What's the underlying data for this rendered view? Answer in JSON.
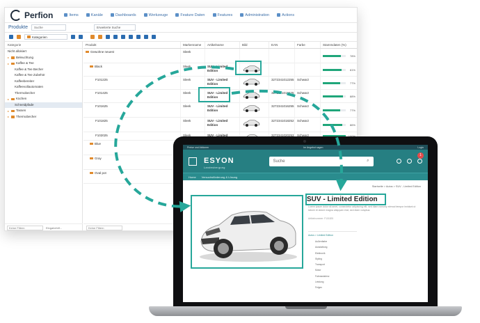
{
  "app": {
    "brand": "Perfion",
    "menu": [
      "Items",
      "Kanäle",
      "Dashboards",
      "Werkzeuge",
      "Feature Daten",
      "Features",
      "Administration",
      "Actions"
    ],
    "tab_title": "Produkte",
    "search_placeholder": "Suche",
    "extended_search": "Erweiterte Suche",
    "category_select": "Kategorien"
  },
  "tree": {
    "header": "Kategorie",
    "items": [
      {
        "label": "Nicht allokiert",
        "level": 0,
        "folder": false
      },
      {
        "label": "Beleuchtung",
        "level": 0,
        "folder": true
      },
      {
        "label": "Kaffee & Tee",
        "level": 0,
        "folder": true
      },
      {
        "label": "Kaffee & Tee Becher",
        "level": 1,
        "folder": false
      },
      {
        "label": "Kaffee & Tee Zubehör",
        "level": 1,
        "folder": false
      },
      {
        "label": "Kaffeebereiter",
        "level": 1,
        "folder": false
      },
      {
        "label": "Kaffeevollautomaten",
        "level": 1,
        "folder": false
      },
      {
        "label": "Thermobecher",
        "level": 1,
        "folder": false
      },
      {
        "label": "Küchen",
        "level": 0,
        "folder": true
      },
      {
        "label": "Schneidpfade",
        "level": 1,
        "folder": false,
        "selected": true
      },
      {
        "label": "Tassen",
        "level": 0,
        "folder": true
      },
      {
        "label": "Thermobecher",
        "level": 0,
        "folder": true
      }
    ],
    "filter_placeholder": "Keine Filtern",
    "footer_text": "Eingabehilf..."
  },
  "grid": {
    "columns": [
      "Produkt",
      "Markenname",
      "Artikelname",
      "Bild",
      "EAN",
      "Farbe",
      "Stammdaten (%)"
    ],
    "rows": [
      {
        "product": "Gewohne neuest",
        "brand": "Sleek",
        "article": "",
        "ean": "",
        "color": "",
        "pct": 78,
        "pct_label": "78%",
        "folder": true,
        "has_img": false,
        "height": 21
      },
      {
        "product": "Black",
        "brand": "Sleek",
        "article": "SUV - Limited Edition",
        "ean": "",
        "color": "",
        "pct": 81,
        "pct_label": "81%",
        "folder": true,
        "has_img": true,
        "height": 19
      },
      {
        "product": "F101225",
        "brand": "Sleek",
        "article": "SUV - Limited Edition",
        "ean": "3272341012255",
        "color": "Schwarz",
        "pct": 77,
        "pct_label": "77%",
        "folder": false,
        "has_img": true,
        "height": 19
      },
      {
        "product": "F101425",
        "brand": "Sleek",
        "article": "SUV - Limited Edition",
        "ean": "3272341012425",
        "color": "Schwarz",
        "pct": 88,
        "pct_label": "88%",
        "folder": false,
        "has_img": true,
        "height": 19
      },
      {
        "product": "F101625",
        "brand": "Sleek",
        "article": "SUV - Limited Edition",
        "ean": "3272341016255",
        "color": "Schwarz",
        "pct": 77,
        "pct_label": "77%",
        "folder": false,
        "has_img": true,
        "height": 21
      },
      {
        "product": "F101825",
        "brand": "Sleek",
        "article": "SUV - Limited Edition",
        "ean": "3272341018252",
        "color": "Schwarz",
        "pct": 86,
        "pct_label": "86%",
        "folder": false,
        "has_img": true,
        "height": 21
      },
      {
        "product": "F102025",
        "brand": "Sleek",
        "article": "SUV - Limited",
        "ean": "3272341020253",
        "color": "Schwarz",
        "pct": 100,
        "pct_label": "100%",
        "folder": false,
        "has_img": true,
        "height": 12
      },
      {
        "product": "Blue",
        "brand": "",
        "article": "",
        "ean": "",
        "color": "",
        "pct": 0,
        "pct_label": "",
        "folder": true,
        "has_img": false,
        "height": 21
      },
      {
        "product": "Gray",
        "brand": "",
        "article": "",
        "ean": "",
        "color": "",
        "pct": 0,
        "pct_label": "",
        "folder": true,
        "has_img": false,
        "height": 21
      },
      {
        "product": "Oval pot",
        "brand": "",
        "article": "",
        "ean": "",
        "color": "",
        "pct": 0,
        "pct_label": "",
        "folder": true,
        "has_img": false,
        "height": 20
      }
    ],
    "filter_placeholder": "Keine Filtern"
  },
  "shop": {
    "brand": "ESYON",
    "brand_sub": "Landesbergung",
    "search_placeholder": "Suche",
    "top_left": "Preise und Aktionen",
    "top_mid": "Im Angebot sagen",
    "top_right": "Login",
    "cart_count": "1",
    "nav": [
      "Home",
      "Versuchsförderung & Lösung"
    ],
    "breadcrumb": "Startseite > Autos > SUV - Limited Edition",
    "title": "SUV - Limited Edition",
    "description": "Lorem ipsum dolor sit amet, consectetur adipiscing elit, sed diam nonumy eirmod tempor invidunt ut labore et dolore magna aliquyam erat, sed diam voluptua.",
    "article_no": "Artikelnummer: F101825",
    "attr_header": "Autos > Limited Edition",
    "attributes": [
      "Außenfarbe",
      "Ausstattung",
      "Elektronik",
      "Styling",
      "Transport",
      "Motor",
      "Fahrassistenz",
      "Leistung",
      "Felgen"
    ]
  },
  "colors": {
    "accent": "#26a79a",
    "shop_header": "#267f82",
    "status_bar": "#1fa67a"
  }
}
